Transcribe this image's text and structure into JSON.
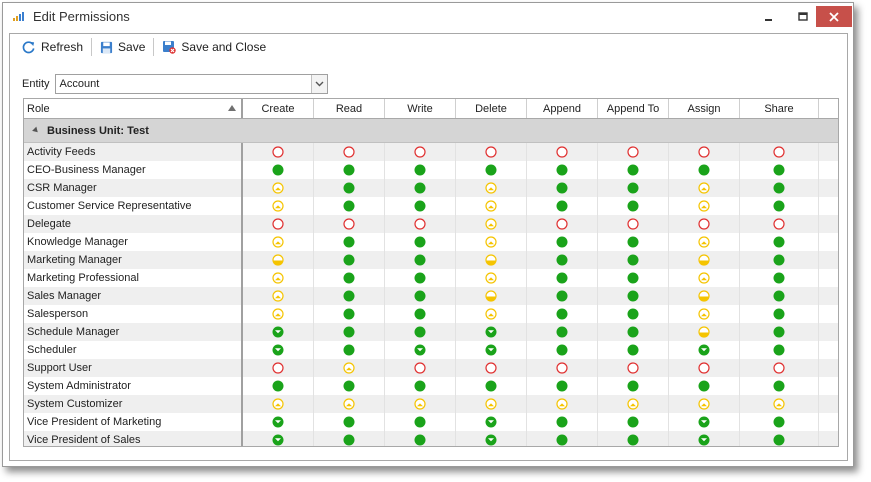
{
  "window": {
    "title": "Edit Permissions"
  },
  "toolbar": {
    "refresh": "Refresh",
    "save": "Save",
    "save_close": "Save and Close"
  },
  "entity": {
    "label": "Entity",
    "value": "Account"
  },
  "grid": {
    "role_header": "Role",
    "columns": [
      "Create",
      "Read",
      "Write",
      "Delete",
      "Append",
      "Append To",
      "Assign",
      "Share"
    ],
    "group_label": "Business Unit: Test",
    "legend": {
      "N": "none",
      "U": "user",
      "B": "business-unit",
      "P": "parent-child",
      "O": "organization"
    },
    "rows": [
      {
        "role": "Activity Feeds",
        "levels": [
          "N",
          "N",
          "N",
          "N",
          "N",
          "N",
          "N",
          "N"
        ]
      },
      {
        "role": "CEO-Business Manager",
        "levels": [
          "O",
          "O",
          "O",
          "O",
          "O",
          "O",
          "O",
          "O"
        ]
      },
      {
        "role": "CSR Manager",
        "levels": [
          "U",
          "O",
          "O",
          "U",
          "O",
          "O",
          "U",
          "O"
        ]
      },
      {
        "role": "Customer Service Representative",
        "levels": [
          "U",
          "O",
          "O",
          "U",
          "O",
          "O",
          "U",
          "O"
        ]
      },
      {
        "role": "Delegate",
        "levels": [
          "N",
          "N",
          "N",
          "U",
          "N",
          "N",
          "N",
          "N"
        ]
      },
      {
        "role": "Knowledge Manager",
        "levels": [
          "U",
          "O",
          "O",
          "U",
          "O",
          "O",
          "U",
          "O"
        ]
      },
      {
        "role": "Marketing Manager",
        "levels": [
          "B",
          "O",
          "O",
          "B",
          "O",
          "O",
          "B",
          "O"
        ]
      },
      {
        "role": "Marketing Professional",
        "levels": [
          "U",
          "O",
          "O",
          "U",
          "O",
          "O",
          "U",
          "O"
        ]
      },
      {
        "role": "Sales Manager",
        "levels": [
          "U",
          "O",
          "O",
          "B",
          "O",
          "O",
          "B",
          "O"
        ]
      },
      {
        "role": "Salesperson",
        "levels": [
          "U",
          "O",
          "O",
          "U",
          "O",
          "O",
          "U",
          "O"
        ]
      },
      {
        "role": "Schedule Manager",
        "levels": [
          "P",
          "O",
          "O",
          "P",
          "O",
          "O",
          "B",
          "O"
        ]
      },
      {
        "role": "Scheduler",
        "levels": [
          "P",
          "O",
          "P",
          "P",
          "O",
          "O",
          "P",
          "O"
        ]
      },
      {
        "role": "Support User",
        "levels": [
          "N",
          "U",
          "N",
          "N",
          "N",
          "N",
          "N",
          "N"
        ]
      },
      {
        "role": "System Administrator",
        "levels": [
          "O",
          "O",
          "O",
          "O",
          "O",
          "O",
          "O",
          "O"
        ]
      },
      {
        "role": "System Customizer",
        "levels": [
          "U",
          "U",
          "U",
          "U",
          "U",
          "U",
          "U",
          "U"
        ]
      },
      {
        "role": "Vice President of Marketing",
        "levels": [
          "P",
          "O",
          "O",
          "P",
          "O",
          "O",
          "P",
          "O"
        ]
      },
      {
        "role": "Vice President of Sales",
        "levels": [
          "P",
          "O",
          "O",
          "P",
          "O",
          "O",
          "P",
          "O"
        ]
      }
    ]
  },
  "colors": {
    "full": "#1aa31a",
    "partial": "#f5c400",
    "none": "#e03030",
    "group_bg": "#d5d5d5"
  }
}
